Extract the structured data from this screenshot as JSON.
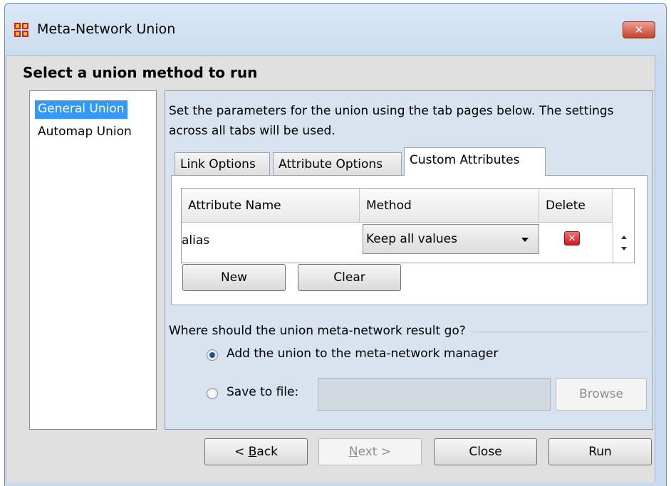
{
  "window": {
    "title": "Meta-Network Union",
    "close_icon": "close-icon"
  },
  "heading": "Select a union method to run",
  "methods": [
    "General Union",
    "Automap Union"
  ],
  "selected_method": "General Union",
  "description": "Set the parameters for the union using the tab pages below. The settings across all tabs will be used.",
  "tabs": [
    "Link Options",
    "Attribute Options",
    "Custom Attributes"
  ],
  "active_tab": "Custom Attributes",
  "table": {
    "columns": [
      "Attribute Name",
      "Method",
      "Delete"
    ],
    "rows": [
      {
        "name": "alias",
        "method": "Keep all values"
      }
    ]
  },
  "table_buttons": {
    "new": "New",
    "clear": "Clear"
  },
  "output": {
    "label": "Where should the union meta-network result go?",
    "option_manager": "Add the union to the meta-network manager",
    "option_file": "Save to file:",
    "file_value": "",
    "browse": "Browse"
  },
  "footer": {
    "back_prefix": "< ",
    "back_key": "B",
    "back_rest": "ack",
    "next_key": "N",
    "next_rest": "ext >",
    "close": "Close",
    "run": "Run"
  }
}
